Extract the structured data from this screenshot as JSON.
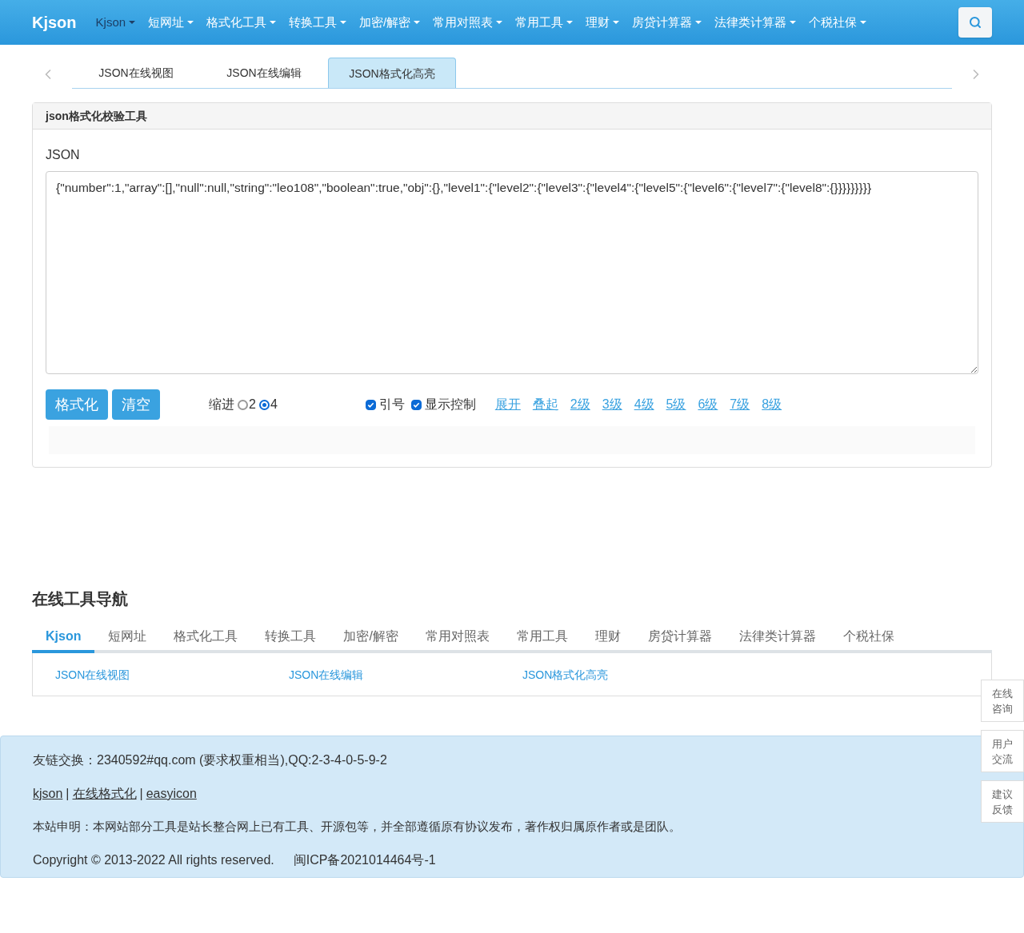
{
  "navbar": {
    "brand": "Kjson",
    "items": [
      {
        "label": "Kjson",
        "selected": true
      },
      {
        "label": "短网址",
        "selected": false
      },
      {
        "label": "格式化工具",
        "selected": false
      },
      {
        "label": "转换工具",
        "selected": false
      },
      {
        "label": "加密/解密",
        "selected": false
      },
      {
        "label": "常用对照表",
        "selected": false
      },
      {
        "label": "常用工具",
        "selected": false
      },
      {
        "label": "理财",
        "selected": false
      },
      {
        "label": "房贷计算器",
        "selected": false
      },
      {
        "label": "法律类计算器",
        "selected": false
      },
      {
        "label": "个税社保",
        "selected": false
      }
    ]
  },
  "page_tabs": [
    {
      "label": "JSON在线视图",
      "selected": false
    },
    {
      "label": "JSON在线编辑",
      "selected": false
    },
    {
      "label": "JSON格式化高亮",
      "selected": true
    }
  ],
  "panel": {
    "title": "json格式化校验工具",
    "field_label": "JSON",
    "json_value": "{\"number\":1,\"array\":[],\"null\":null,\"string\":\"leo108\",\"boolean\":true,\"obj\":{},\"level1\":{\"level2\":{\"level3\":{\"level4\":{\"level5\":{\"level6\":{\"level7\":{\"level8\":{}}}}}}}}}",
    "buttons": [
      "格式化",
      "清空"
    ],
    "indent": {
      "label": "缩进",
      "options": [
        {
          "label": "2",
          "selected": false
        },
        {
          "label": "4",
          "selected": true
        }
      ]
    },
    "checkboxes": [
      {
        "label": "引号",
        "checked": true
      },
      {
        "label": "显示控制",
        "checked": true
      }
    ],
    "links": [
      "展开",
      "叠起",
      "2级",
      "3级",
      "4级",
      "5级",
      "6级",
      "7级",
      "8级"
    ]
  },
  "tool_nav": {
    "title": "在线工具导航",
    "tabs": [
      {
        "label": "Kjson",
        "selected": true
      },
      {
        "label": "短网址",
        "selected": false
      },
      {
        "label": "格式化工具",
        "selected": false
      },
      {
        "label": "转换工具",
        "selected": false
      },
      {
        "label": "加密/解密",
        "selected": false
      },
      {
        "label": "常用对照表",
        "selected": false
      },
      {
        "label": "常用工具",
        "selected": false
      },
      {
        "label": "理财",
        "selected": false
      },
      {
        "label": "房贷计算器",
        "selected": false
      },
      {
        "label": "法律类计算器",
        "selected": false
      },
      {
        "label": "个税社保",
        "selected": false
      }
    ],
    "links": [
      "JSON在线视图",
      "JSON在线编辑",
      "JSON格式化高亮"
    ]
  },
  "footer": {
    "exchange": "友链交换：2340592#qq.com (要求权重相当),QQ:2-3-4-0-5-9-2",
    "links": [
      "kjson",
      "在线格式化",
      "easyicon"
    ],
    "separators": [
      "|",
      "|"
    ],
    "statement": "本站申明：本网站部分工具是站长整合网上已有工具、开源包等，并全部遵循原有协议发布，著作权归属原作者或是团队。",
    "copyright": "Copyright © 2013-2022 All rights reserved.",
    "icp": "闽ICP备2021014464号-1"
  },
  "side_buttons": [
    "在线咨询",
    "用户交流",
    "建议反馈"
  ]
}
